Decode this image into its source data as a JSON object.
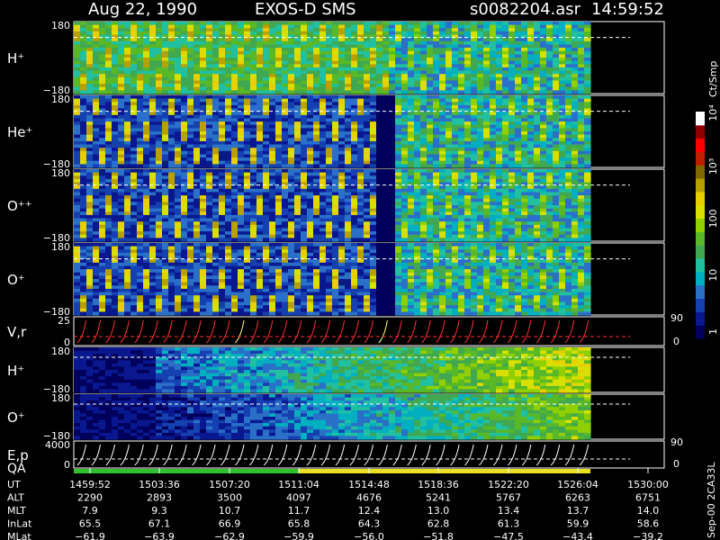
{
  "header": {
    "date": "Aug 22, 1990",
    "instrument": "EXOS-D SMS",
    "file": "s0082204.asr",
    "time": "14:59:52"
  },
  "colorbar": {
    "unit": "Ct/Smp",
    "labels": [
      {
        "text": "1",
        "value": 1
      },
      {
        "text": "10",
        "value": 10
      },
      {
        "text": "100",
        "value": 100
      },
      {
        "text": "10³",
        "value": 1000
      },
      {
        "text": "10⁴",
        "value": 10000
      }
    ],
    "colors": [
      "#00005c",
      "#0a1890",
      "#1540b0",
      "#2a70c8",
      "#00b0c0",
      "#20c0a0",
      "#40a850",
      "#58b828",
      "#90d000",
      "#d8e000",
      "#e8d000",
      "#b8a000",
      "#806800",
      "#c02000",
      "#ff0000",
      "#900000",
      "#ffffff"
    ]
  },
  "chart_data": [
    {
      "type": "heatmap",
      "panel": "H+ pitch angle spectrogram",
      "ylabel": "H⁺",
      "ylim": [
        -180,
        180
      ],
      "ytick_labels": [
        "180",
        "−180"
      ]
    },
    {
      "type": "heatmap",
      "panel": "He+ pitch angle spectrogram",
      "ylabel": "He⁺",
      "ylim": [
        -180,
        180
      ],
      "ytick_labels": [
        "180",
        "−180"
      ]
    },
    {
      "type": "heatmap",
      "panel": "O++ pitch angle spectrogram",
      "ylabel": "O⁺⁺",
      "ylim": [
        -180,
        180
      ],
      "ytick_labels": [
        "180",
        "−180"
      ]
    },
    {
      "type": "heatmap",
      "panel": "O+ pitch angle spectrogram",
      "ylabel": "O⁺",
      "ylim": [
        -180,
        180
      ],
      "ytick_labels": [
        "180",
        "−180"
      ]
    },
    {
      "type": "line",
      "panel": "V,r",
      "ylabel": "V,r",
      "ylim": [
        0,
        25
      ],
      "ytick_labels": [
        "25",
        "0"
      ],
      "right_ticks": [
        "90",
        "0"
      ]
    },
    {
      "type": "heatmap",
      "panel": "H+ lower spectrogram",
      "ylabel": "H⁺",
      "ylim": [
        -180,
        180
      ],
      "ytick_labels": [
        "180",
        "−180"
      ]
    },
    {
      "type": "heatmap",
      "panel": "O+ lower spectrogram",
      "ylabel": "O⁺",
      "ylim": [
        -180,
        180
      ],
      "ytick_labels": [
        "180",
        "−180"
      ]
    },
    {
      "type": "line",
      "panel": "E,p",
      "ylabel": "E,p",
      "ylim": [
        0,
        4000
      ],
      "ytick_labels": [
        "4000",
        "0"
      ],
      "right_ticks": [
        "90",
        "0"
      ]
    }
  ],
  "qa_label": "QA",
  "side_label": "Sep-00 2CA33L",
  "table": {
    "rows": [
      {
        "label": "UT",
        "values": [
          "1459:52",
          "1503:36",
          "1507:20",
          "1511:04",
          "1514:48",
          "1518:36",
          "1522:20",
          "1526:04",
          "1530:00"
        ]
      },
      {
        "label": "ALT",
        "values": [
          "2290",
          "2893",
          "3500",
          "4097",
          "4676",
          "5241",
          "5767",
          "6263",
          "6751"
        ]
      },
      {
        "label": "MLT",
        "values": [
          "7.9",
          "9.3",
          "10.7",
          "11.7",
          "12.4",
          "13.0",
          "13.4",
          "13.7",
          "14.0"
        ]
      },
      {
        "label": "InLat",
        "values": [
          "65.5",
          "67.1",
          "66.9",
          "65.8",
          "64.3",
          "62.8",
          "61.3",
          "59.9",
          "58.6"
        ]
      },
      {
        "label": "MLat",
        "values": [
          "−61.9",
          "−63.9",
          "−62.9",
          "−59.9",
          "−56.0",
          "−51.8",
          "−47.5",
          "−43.4",
          "−39.2"
        ]
      }
    ]
  }
}
